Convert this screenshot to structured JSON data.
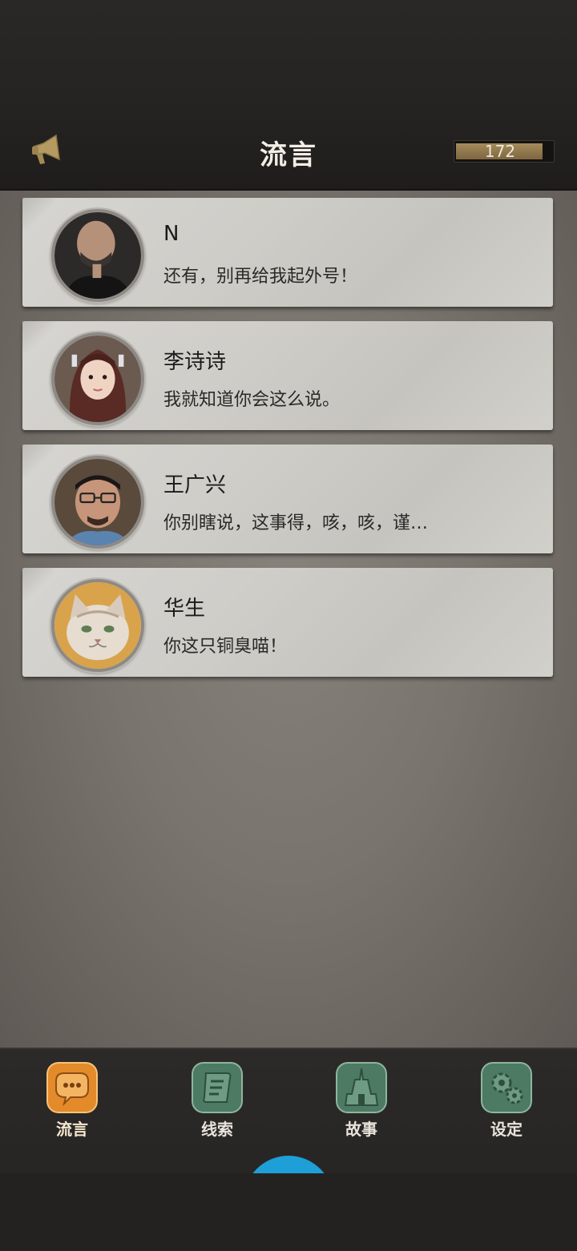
{
  "header": {
    "title": "流言",
    "counter_value": "172",
    "counter_fill": 0.9,
    "icon": "megaphone-icon"
  },
  "rumors": [
    {
      "name": "N",
      "message": "还有，别再给我起外号！",
      "avatar": "man-portrait-avatar"
    },
    {
      "name": "李诗诗",
      "message": "我就知道你会这么说。",
      "avatar": "woman-portrait-avatar"
    },
    {
      "name": "王广兴",
      "message": "你别瞎说，这事得，咳，咳，谨…",
      "avatar": "man-glasses-avatar"
    },
    {
      "name": "华生",
      "message": "你这只铜臭喵！",
      "avatar": "cat-avatar"
    }
  ],
  "tabs": [
    {
      "label": "流言",
      "icon": "chat-bubble-icon",
      "active": true
    },
    {
      "label": "线索",
      "icon": "scroll-icon",
      "active": false
    },
    {
      "label": "故事",
      "icon": "temple-icon",
      "active": false
    },
    {
      "label": "设定",
      "icon": "gear-icon",
      "active": false
    }
  ],
  "colors": {
    "active_tab": "#e38a2a",
    "inactive_tab": "#4c7a63",
    "accent_bubble": "#1e9fd8"
  }
}
